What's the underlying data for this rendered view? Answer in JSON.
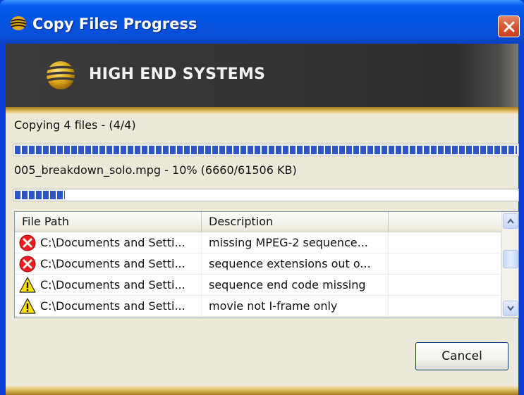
{
  "window": {
    "title": "Copy Files Progress",
    "close_icon": "close-icon"
  },
  "banner": {
    "logo_text": "HIGH END SYSTEMS"
  },
  "progress": {
    "overall_text": "Copying 4 files - (4/4)",
    "overall_fraction": 1.0,
    "file_text": "005_breakdown_solo.mpg - 10% (6660/61506 KB)",
    "file_fraction": 0.1
  },
  "list": {
    "columns": [
      "File Path",
      "Description",
      ""
    ],
    "rows": [
      {
        "icon": "error-icon",
        "path": "C:\\Documents and Setti...",
        "description": "missing MPEG-2 sequence..."
      },
      {
        "icon": "error-icon",
        "path": "C:\\Documents and Setti...",
        "description": "sequence extensions out o..."
      },
      {
        "icon": "warning-icon",
        "path": "C:\\Documents and Setti...",
        "description": "sequence end code missing"
      },
      {
        "icon": "warning-icon",
        "path": "C:\\Documents and Setti...",
        "description": "movie not I-frame only"
      }
    ]
  },
  "buttons": {
    "cancel_label": "Cancel"
  },
  "colors": {
    "titlebar": "#0054e3",
    "progress_fill": "#2c55c8",
    "accent_gold": "#d9b45a"
  }
}
